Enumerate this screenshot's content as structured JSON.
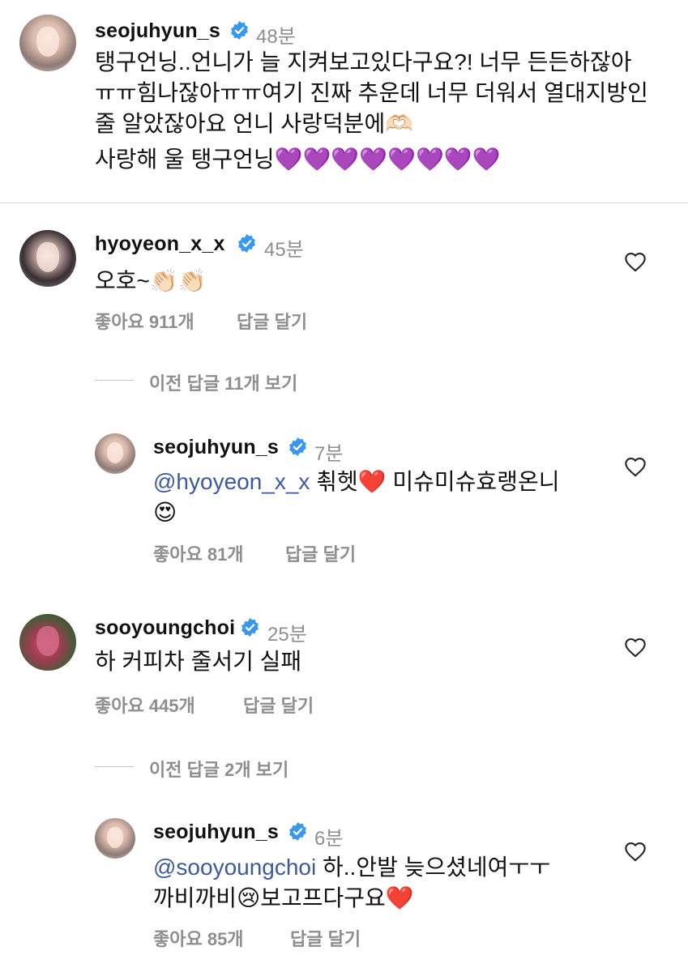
{
  "comments": [
    {
      "username": "seojuhyun_s",
      "time": "48분",
      "lines": [
        "탱구언닝..언니가 늘 지켜보고있다구요?! 너무 든든하잖아",
        "ㅠㅠ힘나잖아ㅠㅠ여기 진짜 추운데 너무 더워서 열대지방인",
        "줄 알았잖아요 언니 사랑덕분에🫶🏻",
        "사랑해 울 탱구언닝💜💜💜💜💜💜💜💜"
      ]
    },
    {
      "username": "hyoyeon_x_x",
      "time": "45분",
      "text": "오호~👏🏻👏🏻",
      "likes": "좋아요 911개",
      "reply": "답글 달기",
      "view_more": "이전 답글 11개 보기",
      "replies": [
        {
          "username": "seojuhyun_s",
          "time": "7분",
          "mention": "@hyoyeon_x_x",
          "line1_rest": " 쵞헷❤️ 미슈미슈효랭온니",
          "line2": "😍",
          "likes": "좋아요 81개",
          "reply": "답글 달기"
        }
      ]
    },
    {
      "username": "sooyoungchoi",
      "time": "25분",
      "text": "하 커피차 줄서기 실패",
      "likes": "좋아요 445개",
      "reply": "답글 달기",
      "view_more": "이전 답글 2개 보기",
      "replies": [
        {
          "username": "seojuhyun_s",
          "time": "6분",
          "mention": "@sooyoungchoi",
          "line1_rest": " 하..안발 늦으셨네여ㅜㅜ",
          "line2": "까비까비😢보고프다구요❤️",
          "likes": "좋아요 85개",
          "reply": "답글 달기"
        }
      ]
    }
  ],
  "colors": {
    "verified": "#3897f0",
    "mention": "#3d5a9e",
    "muted": "#8e8e8e"
  }
}
